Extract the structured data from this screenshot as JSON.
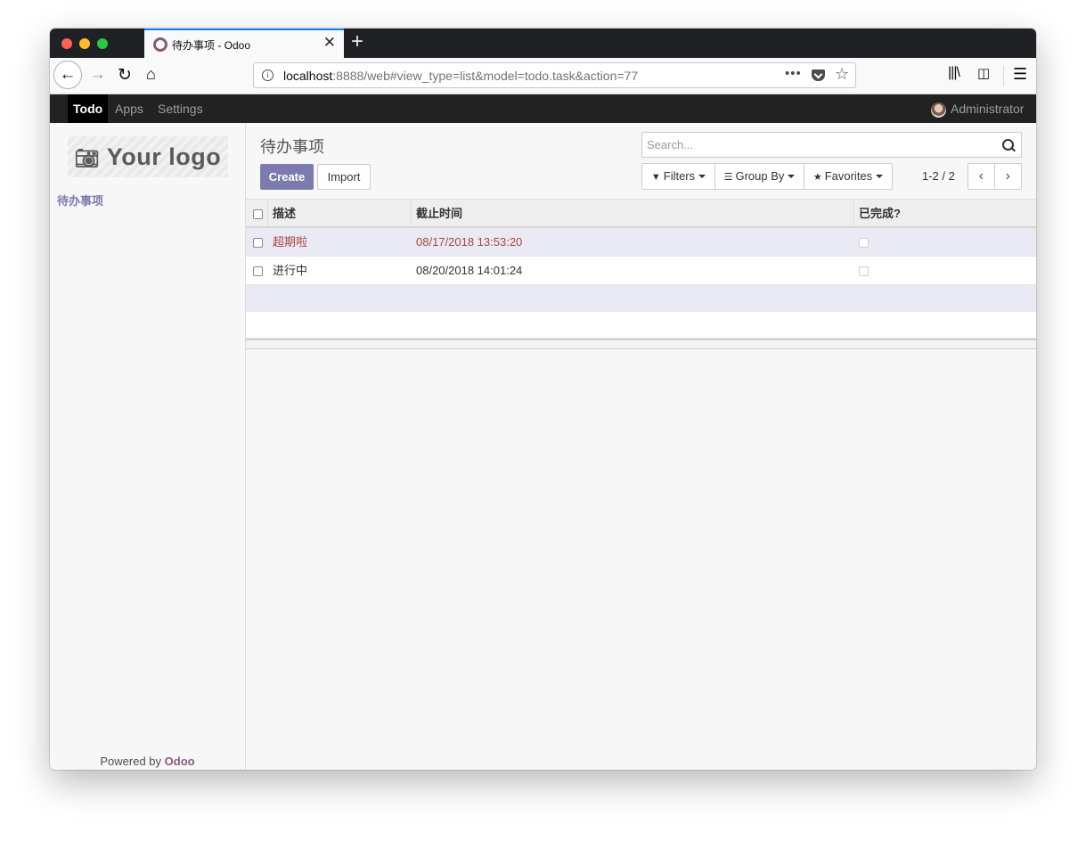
{
  "browser": {
    "tab_title": "待办事项 - Odoo",
    "url_host": "localhost",
    "url_rest": ":8888/web#view_type=list&model=todo.task&action=77"
  },
  "odoo": {
    "menu": {
      "active": "Todo",
      "apps": "Apps",
      "settings": "Settings"
    },
    "user": "Administrator",
    "logo_text": "Your logo",
    "sidebar_link": "待办事项",
    "powered_prefix": "Powered by ",
    "powered_brand": "Odoo"
  },
  "control_panel": {
    "title": "待办事项",
    "create_label": "Create",
    "import_label": "Import",
    "search_placeholder": "Search...",
    "filters_label": "Filters",
    "groupby_label": "Group By",
    "favorites_label": "Favorites",
    "pager": "1-2 / 2"
  },
  "list": {
    "columns": [
      "描述",
      "截止时间",
      "已完成?"
    ],
    "rows": [
      {
        "desc": "超期啦",
        "deadline": "08/17/2018 13:53:20",
        "done": false,
        "overdue": true
      },
      {
        "desc": "进行中",
        "deadline": "08/20/2018 14:01:24",
        "done": false,
        "overdue": false
      }
    ]
  },
  "colors": {
    "accent": "#7c7bad",
    "brand": "#875a7b",
    "overdue": "#a94442",
    "menu_bg": "#222222"
  }
}
